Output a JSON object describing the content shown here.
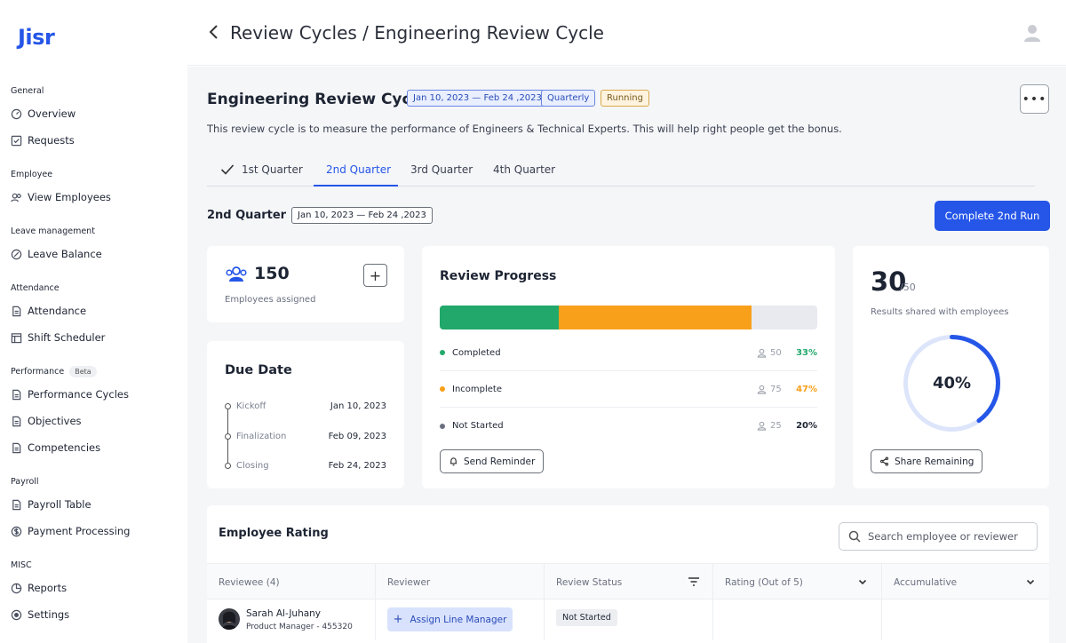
{
  "app": {
    "logo": "Jisr"
  },
  "sidebar": {
    "sections": [
      {
        "label": "General"
      },
      {
        "label": "Employee"
      },
      {
        "label": "Leave management"
      },
      {
        "label": "Attendance"
      },
      {
        "label": "Performance",
        "badge": "Beta"
      },
      {
        "label": "Payroll"
      },
      {
        "label": "MISC"
      }
    ],
    "items": [
      {
        "label": "Overview",
        "icon": "gauge-icon"
      },
      {
        "label": "Requests",
        "icon": "checklist-icon"
      },
      {
        "label": "View Employees",
        "icon": "people-icon"
      },
      {
        "label": "Leave Balance",
        "icon": "percent-icon"
      },
      {
        "label": "Attendance",
        "icon": "document-icon"
      },
      {
        "label": "Shift Scheduler",
        "icon": "calendar-icon"
      },
      {
        "label": "Performance Cycles",
        "icon": "document-icon"
      },
      {
        "label": "Objectives",
        "icon": "document-icon"
      },
      {
        "label": "Competencies",
        "icon": "document-icon"
      },
      {
        "label": "Payroll Table",
        "icon": "document-icon"
      },
      {
        "label": "Payment Processing",
        "icon": "dollar-icon"
      },
      {
        "label": "Reports",
        "icon": "pie-chart-icon"
      },
      {
        "label": "Settings",
        "icon": "radio-icon"
      }
    ]
  },
  "header": {
    "breadcrumb": "Review Cycles / Engineering Review Cycle"
  },
  "cycle": {
    "title": "Engineering Review Cycle",
    "date_range": "Jan 10, 2023 — Feb 24 ,2023",
    "frequency": "Quarterly",
    "status": "Running",
    "more": "•••",
    "description": "This review cycle is to measure the performance of Engineers & Technical Experts. This will help right people get the bonus."
  },
  "tabs": [
    {
      "label": "1st Quarter",
      "done": true
    },
    {
      "label": "2nd Quarter",
      "active": true
    },
    {
      "label": "3rd Quarter"
    },
    {
      "label": "4th Quarter"
    }
  ],
  "quarter": {
    "title": "2nd Quarter",
    "date_range": "Jan 10, 2023 — Feb 24 ,2023",
    "action": "Complete 2nd Run"
  },
  "employees": {
    "count": "150",
    "label": "Employees assigned",
    "add": "+"
  },
  "due_date": {
    "title": "Due Date",
    "milestones": [
      {
        "label": "Kickoff",
        "date": "Jan 10, 2023"
      },
      {
        "label": "Finalization",
        "date": "Feb 09, 2023"
      },
      {
        "label": "Closing",
        "date": "Feb 24, 2023"
      }
    ]
  },
  "progress": {
    "title": "Review Progress",
    "segments": [
      {
        "name": "Completed",
        "count": "50",
        "percent": "33%",
        "fraction": 0.315,
        "color": "#22a86b"
      },
      {
        "name": "Incomplete",
        "count": "75",
        "percent": "47%",
        "fraction": 0.51,
        "color": "#f8a01a"
      },
      {
        "name": "Not Started",
        "count": "25",
        "percent": "20%",
        "fraction": 0.175,
        "color": "#6b7080"
      }
    ],
    "track_color": "#e8eaef",
    "reminder_button": "Send Reminder"
  },
  "results": {
    "shared": "30",
    "total": "/50",
    "label": "Results shared with employees",
    "percent_label": "40%",
    "percent": 0.4,
    "share_button": "Share Remaining",
    "accent": "#2556e8",
    "track": "#dde5fb"
  },
  "rating": {
    "title": "Employee Rating",
    "search_placeholder": "Search employee or reviewer",
    "columns": [
      "Reviewee (4)",
      "Reviewer",
      "Review Status",
      "Rating (Out of 5)",
      "Accumulative"
    ],
    "rows": [
      {
        "name": "Sarah Al-Juhany",
        "role": "Product Manager - 455320",
        "reviewer_action": "Assign Line Manager",
        "status": "Not Started"
      }
    ]
  }
}
